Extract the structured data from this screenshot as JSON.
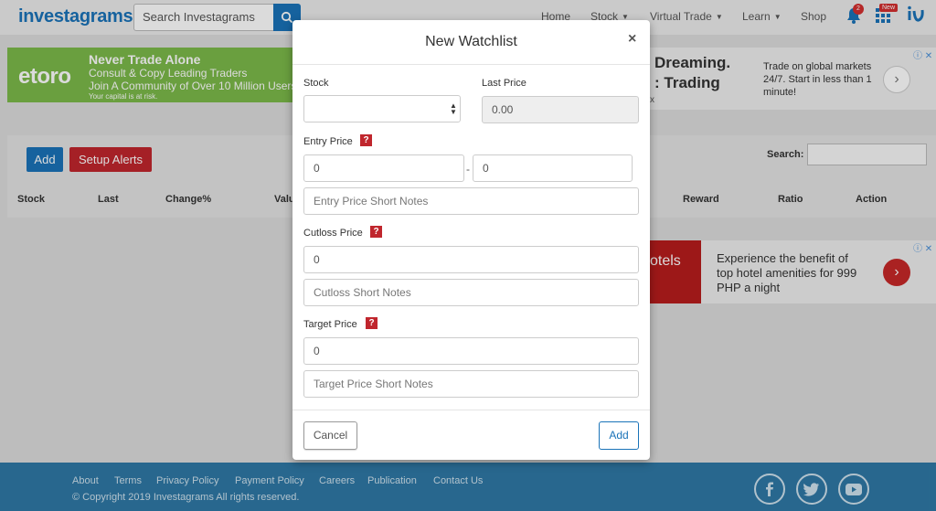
{
  "header": {
    "logo": "investagrams",
    "search_placeholder": "Search Investagrams",
    "nav": [
      "Home",
      "Stock",
      "Virtual Trade",
      "Learn",
      "Shop"
    ],
    "notif_count": "2",
    "new_badge": "New"
  },
  "ad_left": {
    "brand": "etoro",
    "line1": "Never Trade Alone",
    "line2": "Consult & Copy Leading Traders",
    "line3": "Join A Community of Over 10 Million Users",
    "line4": "Your capital is at risk."
  },
  "ad_right": {
    "big1": "Dreaming.",
    "big2": ": Trading",
    "small": "x",
    "text": "Trade on global markets 24/7. Start in less than 1 minute!"
  },
  "ad_right2": {
    "brand": "otels",
    "text": "Experience the benefit of top hotel amenities for 999 PHP a night"
  },
  "panel": {
    "add_label": "Add",
    "alerts_label": "Setup Alerts",
    "search_label": "Search:",
    "columns": [
      "Stock",
      "Last",
      "Change%",
      "Valu",
      "Reward",
      "Ratio",
      "Action"
    ]
  },
  "modal": {
    "title": "New Watchlist",
    "close": "×",
    "stock_label": "Stock",
    "last_price_label": "Last Price",
    "last_price_value": "0.00",
    "entry_label": "Entry Price",
    "entry_from": "0",
    "entry_to": "0",
    "entry_sep": "-",
    "entry_notes_placeholder": "Entry Price Short Notes",
    "cutloss_label": "Cutloss Price",
    "cutloss_value": "0",
    "cutloss_notes_placeholder": "Cutloss Short Notes",
    "target_label": "Target Price",
    "target_value": "0",
    "target_notes_placeholder": "Target Price Short Notes",
    "help": "?",
    "cancel_label": "Cancel",
    "add_label": "Add"
  },
  "footer": {
    "links": [
      "About",
      "Terms",
      "Privacy Policy",
      "Payment Policy",
      "Careers",
      "Publication",
      "Contact Us"
    ],
    "copyright": "© Copyright 2019 Investagrams All rights reserved."
  }
}
